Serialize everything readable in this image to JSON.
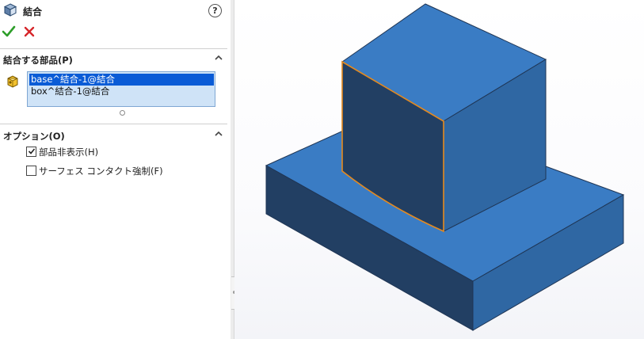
{
  "panel": {
    "title": "結合",
    "help_icon": "help-icon",
    "ok_icon": "green-check-icon",
    "cancel_icon": "red-x-icon"
  },
  "sections": {
    "bodies": {
      "title": "結合する部品(P)",
      "items": [
        {
          "label": "base^結合-1@結合",
          "selected": true
        },
        {
          "label": "box^結合-1@結合",
          "selected": false
        }
      ]
    },
    "options": {
      "title": "オプション(O)",
      "checkboxes": [
        {
          "label": "部品非表示(H)",
          "checked": true
        },
        {
          "label": "サーフェス コンタクト強制(F)",
          "checked": false
        }
      ]
    }
  },
  "colors": {
    "model_top": "#3a7cc4",
    "model_right": "#2f67a3",
    "model_left": "#223f63",
    "edge_highlight": "#e58a1f",
    "selection": "#0a5bd6",
    "listbox_bg": "#cfe3f7"
  }
}
